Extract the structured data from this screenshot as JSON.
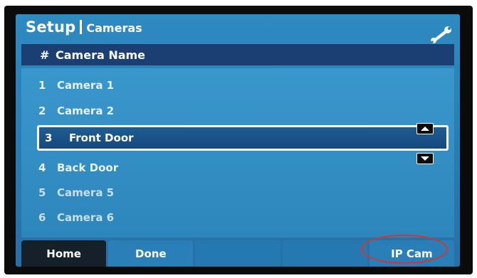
{
  "title": {
    "main": "Setup",
    "sub": "Cameras"
  },
  "icons": {
    "settings": "wrench-icon",
    "scroll_up": "triangle-up-icon",
    "scroll_down": "triangle-down-icon"
  },
  "table": {
    "headers": {
      "number": "#",
      "name": "Camera Name"
    },
    "rows": [
      {
        "number": "1",
        "name": "Camera 1"
      },
      {
        "number": "2",
        "name": "Camera 2"
      },
      {
        "number": "3",
        "name": "Front Door",
        "selected": true
      },
      {
        "number": "4",
        "name": "Back Door"
      },
      {
        "number": "5",
        "name": "Camera 5"
      },
      {
        "number": "6",
        "name": "Camera 6"
      }
    ]
  },
  "tabs": [
    {
      "label": "Home",
      "active": true
    },
    {
      "label": "Done"
    },
    {
      "label": ""
    },
    {
      "label": ""
    },
    {
      "label": "IP Cam"
    }
  ],
  "colors": {
    "screen": "#2f8ac1",
    "header": "#1b3f72",
    "selected": "#14497c",
    "annotation": "#d9332d"
  }
}
